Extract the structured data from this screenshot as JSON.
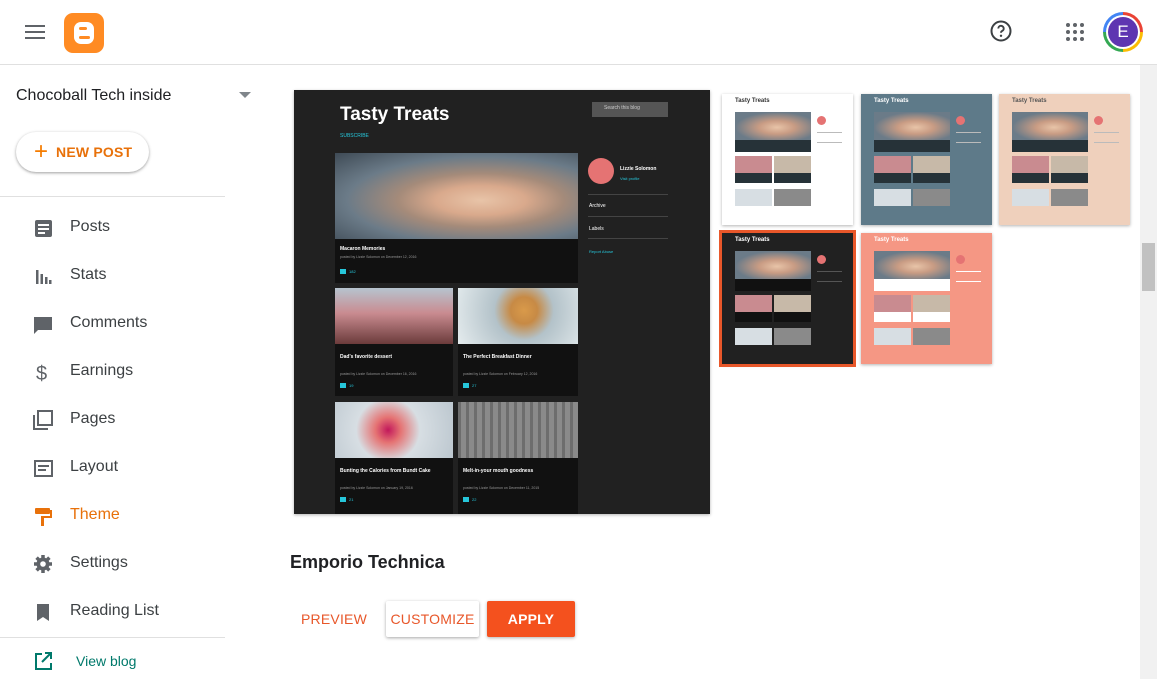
{
  "header": {
    "logo_icon": "blogger-logo-icon",
    "help_icon": "help-circle-icon",
    "apps_icon": "apps-grid-icon",
    "avatar_initial": "E"
  },
  "sidebar": {
    "blog_name": "Chocoball Tech inside",
    "new_post_label": "NEW POST",
    "items": [
      {
        "label": "Posts",
        "icon": "posts-icon"
      },
      {
        "label": "Stats",
        "icon": "stats-icon"
      },
      {
        "label": "Comments",
        "icon": "comments-icon"
      },
      {
        "label": "Earnings",
        "icon": "dollar-icon"
      },
      {
        "label": "Pages",
        "icon": "pages-icon"
      },
      {
        "label": "Layout",
        "icon": "layout-icon"
      },
      {
        "label": "Theme",
        "icon": "paint-roller-icon",
        "active": true
      },
      {
        "label": "Settings",
        "icon": "gear-icon"
      },
      {
        "label": "Reading List",
        "icon": "bookmark-icon"
      }
    ],
    "view_blog_label": "View blog"
  },
  "preview": {
    "blog_title": "Tasty Treats",
    "subscribe": "SUBSCRIBE",
    "search_placeholder": "Search this blog",
    "author_name": "Lizzie Solomon",
    "visit_profile": "Visit profile",
    "archive_label": "Archive",
    "labels_label": "Labels",
    "report_abuse": "Report Abuse",
    "posts": [
      {
        "title": "Macaron Memories",
        "meta": "posted by Lizzie Solomon on December 12, 2016",
        "count": "182"
      },
      {
        "title": "Dad's favorite dessert",
        "meta": "posted by Lizzie Solomon on December 16, 2016",
        "count": "19"
      },
      {
        "title": "The Perfect Breakfast Dinner",
        "meta": "posted by Lizzie Solomon on February 12, 2016",
        "count": "27"
      },
      {
        "title": "Bunting the Calories from Bundt Cake",
        "meta": "posted by Lizzie Solomon on January 19, 2016",
        "count": "21"
      },
      {
        "title": "Melt-in-your mouth goodness",
        "meta": "posted by Lizzie Solomon on December 11, 2015",
        "count": "22"
      }
    ]
  },
  "thumbnails": [
    {
      "title": "Tasty Treats",
      "bg": "#ffffff",
      "title_color": "#333333"
    },
    {
      "title": "Tasty Treats",
      "bg": "#5e7a89",
      "title_color": "#ffffff"
    },
    {
      "title": "Tasty Treats",
      "bg": "#efd0bc",
      "title_color": "#555555"
    },
    {
      "title": "Tasty Treats",
      "bg": "#212121",
      "title_color": "#ffffff"
    },
    {
      "title": "Tasty Treats",
      "bg": "#f59784",
      "title_color": "#ffffff"
    }
  ],
  "theme": {
    "name": "Emporio Technica",
    "preview_label": "PREVIEW",
    "customize_label": "CUSTOMIZE",
    "apply_label": "APPLY"
  },
  "colors": {
    "accent": "#e8710a",
    "apply": "#f4511e",
    "selected_outline": "#e8572a"
  }
}
